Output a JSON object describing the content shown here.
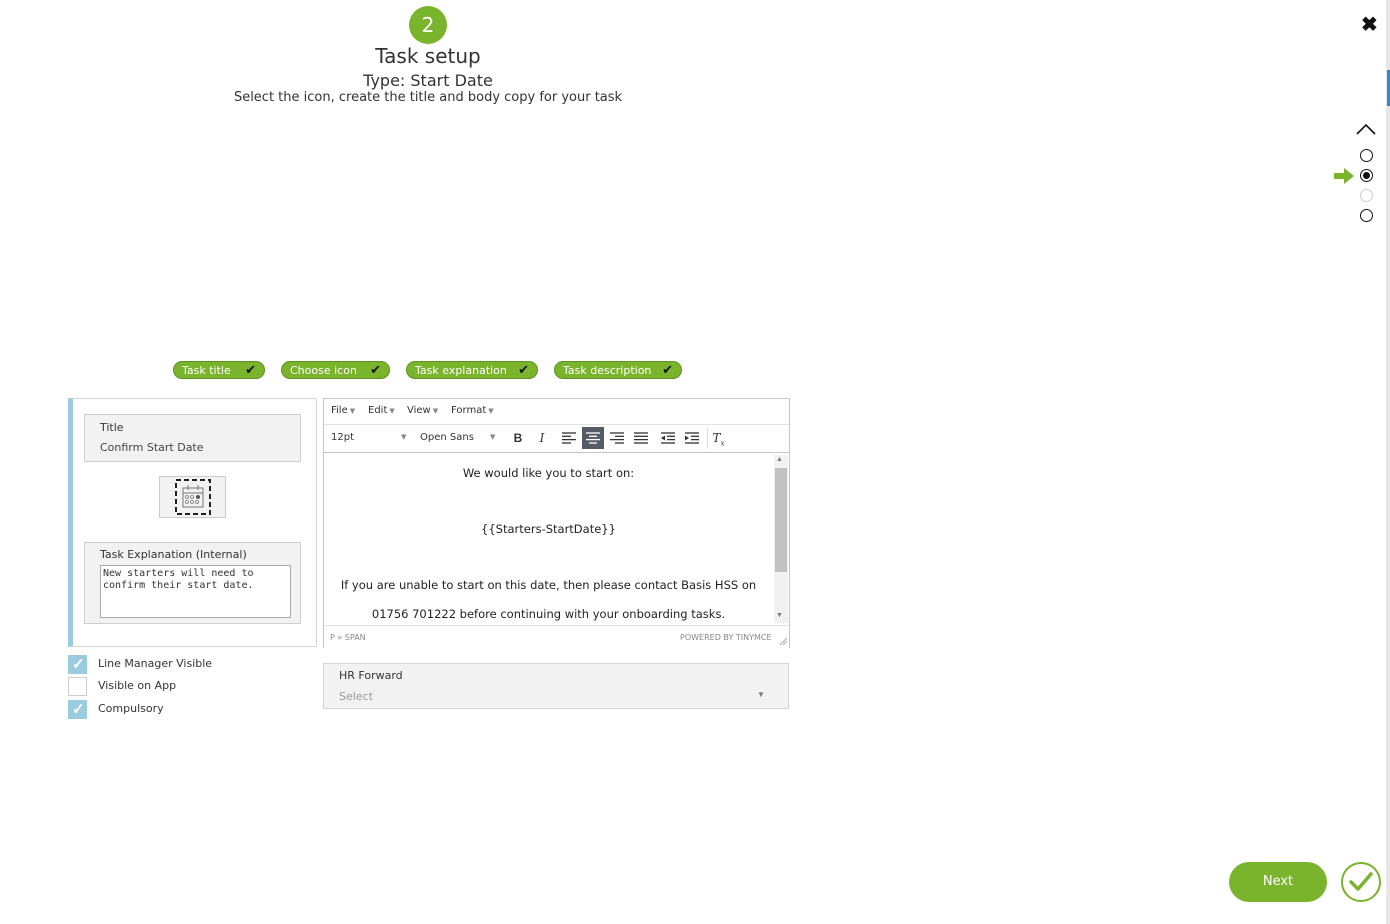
{
  "header": {
    "step_number": "2",
    "title": "Task setup",
    "type": "Type: Start Date",
    "subtitle": "Select the icon, create the title and body copy for your task"
  },
  "close_symbol": "✖",
  "pills": [
    {
      "label": "Task title",
      "status": "complete"
    },
    {
      "label": "Choose icon",
      "status": "complete"
    },
    {
      "label": "Task explanation",
      "status": "complete"
    },
    {
      "label": "Task description",
      "status": "complete"
    }
  ],
  "left_panel": {
    "title_label": "Title",
    "title_value": "Confirm Start Date",
    "icon_name": "calendar-icon",
    "explanation_label": "Task Explanation (Internal)",
    "explanation_value": "New starters will need to confirm their start date."
  },
  "checkboxes": [
    {
      "label": "Line Manager Visible",
      "checked": true
    },
    {
      "label": "Visible on App",
      "checked": false
    },
    {
      "label": "Compulsory",
      "checked": true
    }
  ],
  "editor": {
    "menu": [
      "File",
      "Edit",
      "View",
      "Format"
    ],
    "font_size": "12pt",
    "font_family": "Open Sans",
    "content": [
      "We would like you to start on:",
      "{{Starters-StartDate}}",
      "If you are unable to start on this date, then please contact Basis HSS on",
      "01756 701222 before continuing with your onboarding tasks."
    ],
    "path": "P » SPAN",
    "powered": "POWERED BY TINYMCE"
  },
  "hr_forward": {
    "label": "HR Forward",
    "placeholder": "Select"
  },
  "footer": {
    "next_label": "Next"
  },
  "colors": {
    "brand_green": "#7ab42c",
    "accent_blue": "#9bcbde"
  }
}
